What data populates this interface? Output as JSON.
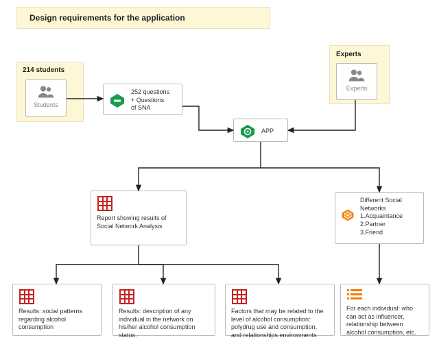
{
  "title": "Design requirements for the application",
  "students_header": "214 students",
  "students_caption": "Students",
  "experts_header": "Experts",
  "experts_caption": "Experts",
  "questions_line1": "252 questions",
  "questions_line2": "+ Questions",
  "questions_line3": "of SNA",
  "app_label": "APP",
  "sna_report": "Report showing results of Social Network Analysis",
  "networks_header": "Different Social Networks",
  "networks_item1": "1.Acquaintance",
  "networks_item2": "2.Partner",
  "networks_item3": "3.Friend",
  "result_a": "Results: social patterns regarding alcohol consumption",
  "result_b": "Results: description of any individual in the network on his/her alcohol consumption status.",
  "result_c": "Factors that may be related to the level of alcohol consumption: polydrug use and consumption, and relationships environments",
  "result_d": "For each individual: who can act as influencer, relationship between alcohol consumption, etc.",
  "chart_data": {
    "type": "diagram",
    "title": "Design requirements for the application",
    "nodes": [
      {
        "id": "students",
        "label": "214 students",
        "caption": "Students"
      },
      {
        "id": "questions",
        "label": "252 questions + Questions of SNA"
      },
      {
        "id": "experts",
        "label": "Experts"
      },
      {
        "id": "app",
        "label": "APP"
      },
      {
        "id": "sna_report",
        "label": "Report showing results of Social Network Analysis"
      },
      {
        "id": "networks",
        "label": "Different Social Networks",
        "items": [
          "Acquaintance",
          "Partner",
          "Friend"
        ]
      },
      {
        "id": "result_a",
        "label": "Results: social patterns regarding alcohol consumption"
      },
      {
        "id": "result_b",
        "label": "Results: description of any individual in the network on his/her alcohol consumption status."
      },
      {
        "id": "result_c",
        "label": "Factors that may be related to the level of alcohol consumption: polydrug use and consumption, and relationships environments"
      },
      {
        "id": "result_d",
        "label": "For each individual: who can act as influencer, relationship between alcohol consumption, etc."
      }
    ],
    "edges": [
      [
        "students",
        "questions"
      ],
      [
        "questions",
        "app"
      ],
      [
        "experts",
        "app"
      ],
      [
        "app",
        "sna_report"
      ],
      [
        "app",
        "networks"
      ],
      [
        "sna_report",
        "result_a"
      ],
      [
        "sna_report",
        "result_b"
      ],
      [
        "sna_report",
        "result_c"
      ],
      [
        "networks",
        "result_d"
      ]
    ]
  }
}
